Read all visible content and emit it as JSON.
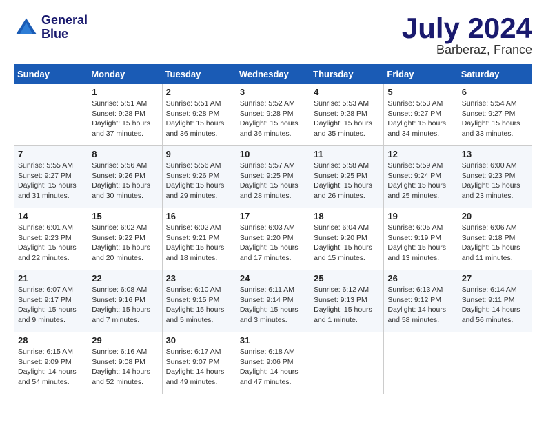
{
  "header": {
    "logo_line1": "General",
    "logo_line2": "Blue",
    "month": "July 2024",
    "location": "Barberaz, France"
  },
  "columns": [
    "Sunday",
    "Monday",
    "Tuesday",
    "Wednesday",
    "Thursday",
    "Friday",
    "Saturday"
  ],
  "weeks": [
    [
      {
        "date": "",
        "info": ""
      },
      {
        "date": "1",
        "info": "Sunrise: 5:51 AM\nSunset: 9:28 PM\nDaylight: 15 hours\nand 37 minutes."
      },
      {
        "date": "2",
        "info": "Sunrise: 5:51 AM\nSunset: 9:28 PM\nDaylight: 15 hours\nand 36 minutes."
      },
      {
        "date": "3",
        "info": "Sunrise: 5:52 AM\nSunset: 9:28 PM\nDaylight: 15 hours\nand 36 minutes."
      },
      {
        "date": "4",
        "info": "Sunrise: 5:53 AM\nSunset: 9:28 PM\nDaylight: 15 hours\nand 35 minutes."
      },
      {
        "date": "5",
        "info": "Sunrise: 5:53 AM\nSunset: 9:27 PM\nDaylight: 15 hours\nand 34 minutes."
      },
      {
        "date": "6",
        "info": "Sunrise: 5:54 AM\nSunset: 9:27 PM\nDaylight: 15 hours\nand 33 minutes."
      }
    ],
    [
      {
        "date": "7",
        "info": "Sunrise: 5:55 AM\nSunset: 9:27 PM\nDaylight: 15 hours\nand 31 minutes."
      },
      {
        "date": "8",
        "info": "Sunrise: 5:56 AM\nSunset: 9:26 PM\nDaylight: 15 hours\nand 30 minutes."
      },
      {
        "date": "9",
        "info": "Sunrise: 5:56 AM\nSunset: 9:26 PM\nDaylight: 15 hours\nand 29 minutes."
      },
      {
        "date": "10",
        "info": "Sunrise: 5:57 AM\nSunset: 9:25 PM\nDaylight: 15 hours\nand 28 minutes."
      },
      {
        "date": "11",
        "info": "Sunrise: 5:58 AM\nSunset: 9:25 PM\nDaylight: 15 hours\nand 26 minutes."
      },
      {
        "date": "12",
        "info": "Sunrise: 5:59 AM\nSunset: 9:24 PM\nDaylight: 15 hours\nand 25 minutes."
      },
      {
        "date": "13",
        "info": "Sunrise: 6:00 AM\nSunset: 9:23 PM\nDaylight: 15 hours\nand 23 minutes."
      }
    ],
    [
      {
        "date": "14",
        "info": "Sunrise: 6:01 AM\nSunset: 9:23 PM\nDaylight: 15 hours\nand 22 minutes."
      },
      {
        "date": "15",
        "info": "Sunrise: 6:02 AM\nSunset: 9:22 PM\nDaylight: 15 hours\nand 20 minutes."
      },
      {
        "date": "16",
        "info": "Sunrise: 6:02 AM\nSunset: 9:21 PM\nDaylight: 15 hours\nand 18 minutes."
      },
      {
        "date": "17",
        "info": "Sunrise: 6:03 AM\nSunset: 9:20 PM\nDaylight: 15 hours\nand 17 minutes."
      },
      {
        "date": "18",
        "info": "Sunrise: 6:04 AM\nSunset: 9:20 PM\nDaylight: 15 hours\nand 15 minutes."
      },
      {
        "date": "19",
        "info": "Sunrise: 6:05 AM\nSunset: 9:19 PM\nDaylight: 15 hours\nand 13 minutes."
      },
      {
        "date": "20",
        "info": "Sunrise: 6:06 AM\nSunset: 9:18 PM\nDaylight: 15 hours\nand 11 minutes."
      }
    ],
    [
      {
        "date": "21",
        "info": "Sunrise: 6:07 AM\nSunset: 9:17 PM\nDaylight: 15 hours\nand 9 minutes."
      },
      {
        "date": "22",
        "info": "Sunrise: 6:08 AM\nSunset: 9:16 PM\nDaylight: 15 hours\nand 7 minutes."
      },
      {
        "date": "23",
        "info": "Sunrise: 6:10 AM\nSunset: 9:15 PM\nDaylight: 15 hours\nand 5 minutes."
      },
      {
        "date": "24",
        "info": "Sunrise: 6:11 AM\nSunset: 9:14 PM\nDaylight: 15 hours\nand 3 minutes."
      },
      {
        "date": "25",
        "info": "Sunrise: 6:12 AM\nSunset: 9:13 PM\nDaylight: 15 hours\nand 1 minute."
      },
      {
        "date": "26",
        "info": "Sunrise: 6:13 AM\nSunset: 9:12 PM\nDaylight: 14 hours\nand 58 minutes."
      },
      {
        "date": "27",
        "info": "Sunrise: 6:14 AM\nSunset: 9:11 PM\nDaylight: 14 hours\nand 56 minutes."
      }
    ],
    [
      {
        "date": "28",
        "info": "Sunrise: 6:15 AM\nSunset: 9:09 PM\nDaylight: 14 hours\nand 54 minutes."
      },
      {
        "date": "29",
        "info": "Sunrise: 6:16 AM\nSunset: 9:08 PM\nDaylight: 14 hours\nand 52 minutes."
      },
      {
        "date": "30",
        "info": "Sunrise: 6:17 AM\nSunset: 9:07 PM\nDaylight: 14 hours\nand 49 minutes."
      },
      {
        "date": "31",
        "info": "Sunrise: 6:18 AM\nSunset: 9:06 PM\nDaylight: 14 hours\nand 47 minutes."
      },
      {
        "date": "",
        "info": ""
      },
      {
        "date": "",
        "info": ""
      },
      {
        "date": "",
        "info": ""
      }
    ]
  ]
}
